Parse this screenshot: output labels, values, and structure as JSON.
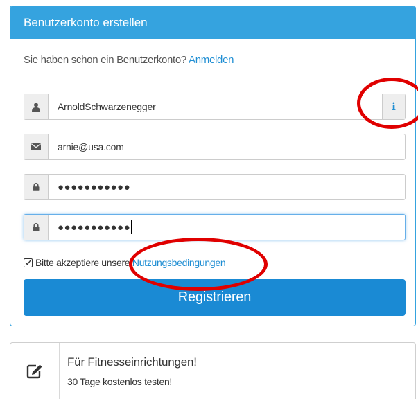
{
  "panel": {
    "title": "Benutzerkonto erstellen",
    "login_prompt_text": "Sie haben schon ein Benutzerkonto?",
    "login_link": "Anmelden"
  },
  "form": {
    "username": {
      "value": "ArnoldSchwarzenegger",
      "icon": "user-icon",
      "info_icon_label": "i"
    },
    "email": {
      "value": "arnie@usa.com",
      "icon": "envelope-icon"
    },
    "password": {
      "masked_value": "●●●●●●●●●●●",
      "icon": "lock-icon"
    },
    "password_confirm": {
      "masked_value": "●●●●●●●●●●●",
      "icon": "lock-icon"
    },
    "terms": {
      "checked": true,
      "text": "Bitte akzeptiere unsere",
      "link": "Nutzungsbedingungen"
    },
    "submit_label": "Registrieren"
  },
  "promo": {
    "icon": "edit-icon",
    "title": "Für Fitnesseinrichtungen!",
    "subtitle": "30 Tage kostenlos testen!"
  },
  "colors": {
    "accent": "#35a3df",
    "button": "#1a8ad4",
    "link": "#1f8ed3",
    "annotation": "#e00000"
  }
}
